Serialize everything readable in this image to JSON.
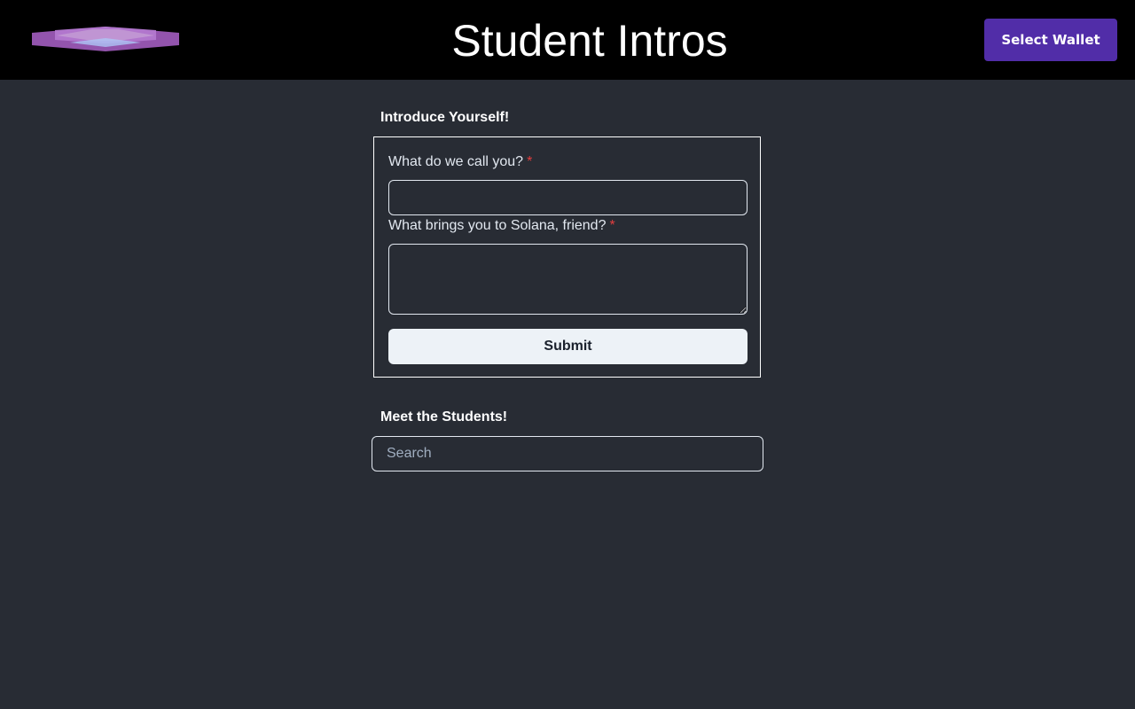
{
  "header": {
    "title": "Student Intros",
    "wallet_button": "Select Wallet",
    "logo_icon": "solana-logo-icon"
  },
  "intro_form": {
    "heading": "Introduce Yourself!",
    "name_label": "What do we call you?",
    "name_required_mark": "*",
    "name_value": "",
    "message_label": "What brings you to Solana, friend?",
    "message_required_mark": "*",
    "message_value": "",
    "submit_label": "Submit"
  },
  "students": {
    "heading": "Meet the Students!",
    "search_placeholder": "Search",
    "search_value": ""
  },
  "colors": {
    "background": "#282c34",
    "header_background": "#000000",
    "wallet_button": "#512da8",
    "required_mark": "#e53e3e",
    "submit_button": "#edf2f7"
  }
}
